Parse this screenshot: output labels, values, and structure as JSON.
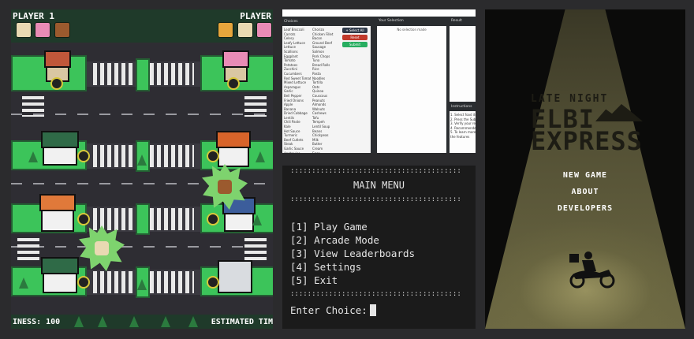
{
  "game": {
    "player1_label": "PLAYER 1",
    "player2_label": "PLAYER",
    "bottom_left_label": "INESS: 100",
    "bottom_right_label": "ESTIMATED TIM",
    "player1_foods": [
      "sushi-icon",
      "donut-icon",
      "coffee-icon"
    ],
    "player2_foods": [
      "pizza-icon",
      "sushi-icon",
      "donut-icon"
    ]
  },
  "webapp": {
    "choices_header": "Choices",
    "select_all_label": "+ Select All",
    "reset_label": "Reset",
    "submit_label": "Submit",
    "your_selection_header": "Your Selection",
    "no_selection_text": "No selection made",
    "result_header": "Result",
    "instructions_header": "Instructions",
    "choices_left": [
      "Leaf Broccoli",
      "Carrots",
      "Celery",
      "Leafy Lettuce",
      "Lettuce",
      "Scallions",
      "Eggplant",
      "Tomato",
      "",
      "Potatoes",
      "Zucchini",
      "Cucumbers",
      "Red Sweet Tomato",
      "Mixed Lettuce",
      "Asparagus",
      "Garlic",
      "Bell Pepper",
      "Fried Onions",
      "Apple",
      "Banana",
      "Dried Cabbage",
      "Lentils",
      "Chili Paste",
      "",
      "Kale",
      "Hot Sauce",
      "Turmeric",
      "",
      "Beef Cutlets",
      "Steak",
      "Garlic Sauce",
      "Anchovies",
      "Baby Shrimp",
      "Lamb Chop",
      "",
      "Cheese",
      "Plum",
      "Yoghurt"
    ],
    "choices_right": [
      "Chorizo",
      "Chicken Fillet",
      "Bacon",
      "Ground Beef",
      "Sausage",
      "Salmon",
      "Pork Chops",
      "Tuna",
      "Bread Rolls",
      "Rice",
      "Pasta",
      "Noodles",
      "Tortilla",
      "Oats",
      "Quinoa",
      "Couscous",
      "Peanuts",
      "Almonds",
      "Walnuts",
      "Cashews",
      "Tofu",
      "Tempeh",
      "Lentil Soup",
      "Beans",
      "Chickpeas",
      "Milk",
      "Butter",
      "Cream",
      "Eggs",
      "Honey",
      "Soy Sauce",
      "Vinegar",
      "Olive Oil",
      "Salt",
      "Pepper",
      "Sugar",
      "Flour",
      "Yeast"
    ],
    "instructions_lines": [
      "1. Select food items",
      "2. Press the Submit button",
      "3. Verify your result",
      "4. Recommended choices",
      "",
      "5. To learn more about",
      "   the features"
    ]
  },
  "terminal": {
    "dots": "::::::::::::::::::::::::::::::::::::::::",
    "title": "MAIN MENU",
    "items": [
      "[1] Play Game",
      "[2] Arcade Mode",
      "[3] View Leaderboards",
      "[4] Settings",
      "[5] Exit"
    ],
    "prompt": "Enter Choice:"
  },
  "title_screen": {
    "logo_small": "LATE NIGHT",
    "logo_line1": "ELBI",
    "logo_line2": "EXPRESS",
    "menu": [
      "NEW GAME",
      "ABOUT",
      "DEVELOPERS"
    ]
  },
  "colors": {
    "grass": "#3cc45a",
    "hud": "#1f3a2a",
    "terminal_bg": "#1b1b1b",
    "beam": "#6d6943"
  }
}
